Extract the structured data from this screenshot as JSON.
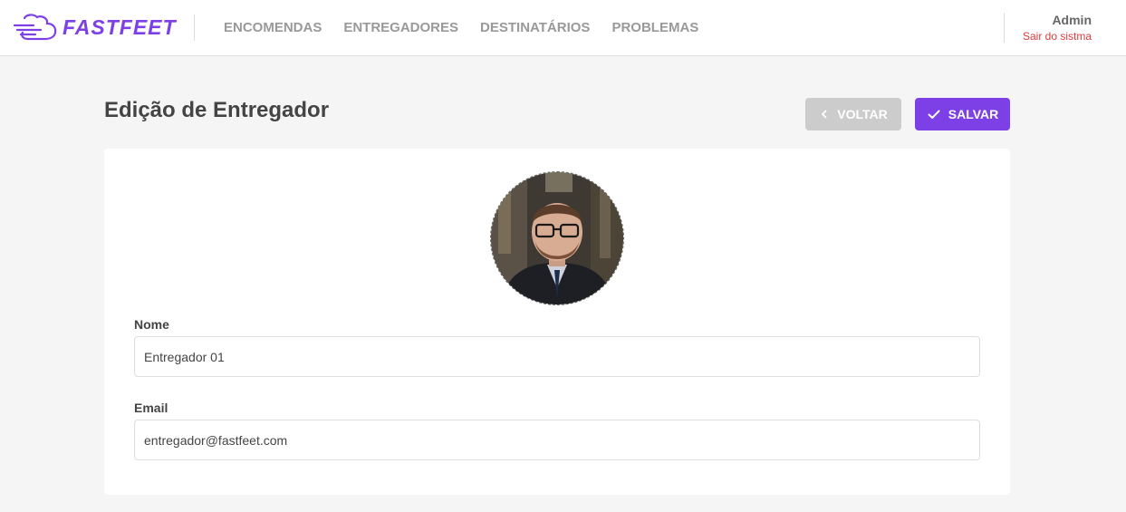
{
  "header": {
    "logo_text": "FASTFEET",
    "nav": [
      "ENCOMENDAS",
      "ENTREGADORES",
      "DESTINATÁRIOS",
      "PROBLEMAS"
    ],
    "user_name": "Admin",
    "logout_label": "Sair do sistma"
  },
  "page": {
    "title": "Edição de Entregador",
    "back_label": "VOLTAR",
    "save_label": "SALVAR"
  },
  "form": {
    "name_label": "Nome",
    "name_value": "Entregador 01",
    "email_label": "Email",
    "email_value": "entregador@fastfeet.com"
  },
  "colors": {
    "brand": "#7d40e7",
    "logout": "#de3b3b",
    "back_button": "#cccccc"
  }
}
